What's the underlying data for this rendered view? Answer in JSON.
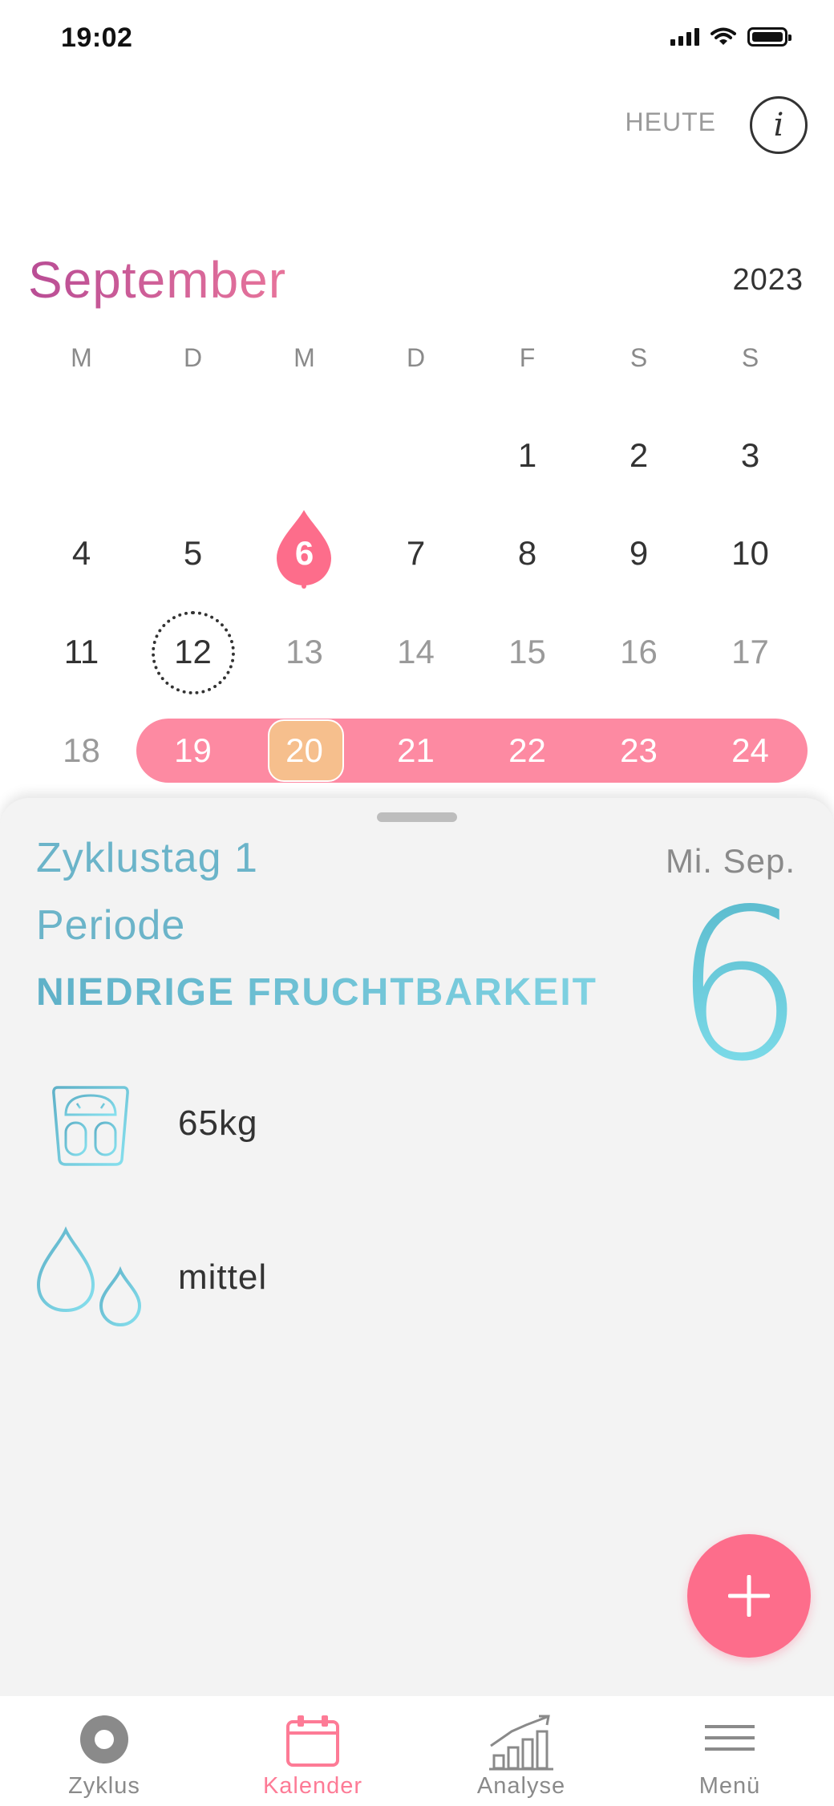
{
  "status_bar": {
    "time": "19:02"
  },
  "header": {
    "today_label": "HEUTE",
    "info_label": "i"
  },
  "calendar": {
    "month": "September",
    "year": "2023",
    "weekdays": [
      "M",
      "D",
      "M",
      "D",
      "F",
      "S",
      "S"
    ],
    "days": [
      "1",
      "2",
      "3",
      "4",
      "5",
      "6",
      "7",
      "8",
      "9",
      "10",
      "11",
      "12",
      "13",
      "14",
      "15",
      "16",
      "17",
      "18",
      "19",
      "20",
      "21",
      "22",
      "23",
      "24"
    ],
    "selected_day": "6",
    "today_day": "12",
    "period_days": [
      "19",
      "20",
      "21",
      "22",
      "23",
      "24"
    ],
    "ovulation_day": "20"
  },
  "detail": {
    "cycle_day": "Zyklustag 1",
    "phase": "Periode",
    "fertility": "NIEDRIGE FRUCHTBARKEIT",
    "weekday_month": "Mi. Sep.",
    "day_number": "6",
    "entries": [
      {
        "icon": "scale-icon",
        "value": "65kg"
      },
      {
        "icon": "bleeding-drops-icon",
        "value": "mittel"
      }
    ]
  },
  "fab": {
    "icon": "plus-icon"
  },
  "tabs": [
    {
      "label": "Zyklus",
      "icon": "cycle-icon",
      "active": false
    },
    {
      "label": "Kalender",
      "icon": "calendar-icon",
      "active": true
    },
    {
      "label": "Analyse",
      "icon": "chart-icon",
      "active": false
    },
    {
      "label": "Menü",
      "icon": "menu-icon",
      "active": false
    }
  ],
  "colors": {
    "accent_pink": "#fd6d8b",
    "period_band": "#fd8aa2",
    "ovulation": "#f6bf8d",
    "teal": "#6bb4c9"
  }
}
